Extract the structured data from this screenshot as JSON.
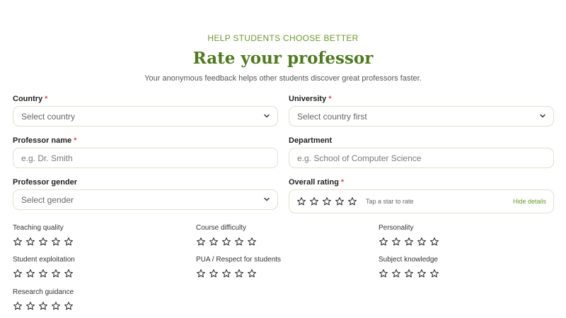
{
  "header": {
    "eyebrow": "HELP STUDENTS CHOOSE BETTER",
    "title": "Rate your professor",
    "subtitle": "Your anonymous feedback helps other students discover great professors faster."
  },
  "form": {
    "country": {
      "label": "Country",
      "required": "*",
      "value": "Select country"
    },
    "university": {
      "label": "University",
      "required": "*",
      "value": "Select country first"
    },
    "professor_name": {
      "label": "Professor name",
      "required": "*",
      "placeholder": "e.g. Dr. Smith"
    },
    "department": {
      "label": "Department",
      "placeholder": "e.g. School of Computer Science"
    },
    "professor_gender": {
      "label": "Professor gender",
      "value": "Select gender"
    },
    "overall_rating": {
      "label": "Overall rating",
      "required": "*",
      "hint": "Tap a star to rate",
      "toggle": "Hide details",
      "stars": 0,
      "max": 5
    }
  },
  "details": [
    {
      "label": "Teaching quality",
      "stars": 0
    },
    {
      "label": "Course difficulty",
      "stars": 0
    },
    {
      "label": "Personality",
      "stars": 0
    },
    {
      "label": "Student exploitation",
      "stars": 0
    },
    {
      "label": "PUA / Respect for students",
      "stars": 0
    },
    {
      "label": "Subject knowledge",
      "stars": 0
    },
    {
      "label": "Research guidance",
      "stars": 0
    }
  ],
  "colors": {
    "accent": "#6a9a2c",
    "title": "#4f7a1e",
    "required": "#d9534f",
    "border": "#dde3cf"
  },
  "icons": {
    "star": "star-outline-icon",
    "chevron": "chevron-down-icon"
  }
}
